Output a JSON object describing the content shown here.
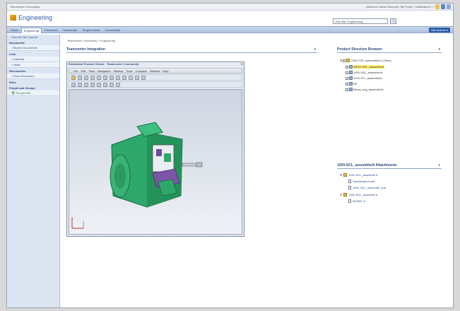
{
  "topbar": {
    "left_text": "Teamcenter Community",
    "right_text": "Welcome Esther Bancroft | My Profile | Notifications | ?"
  },
  "brand": {
    "title": "Engineering"
  },
  "search": {
    "value": "This Site: Engineering",
    "button": "🔍"
  },
  "nav": {
    "tabs": [
      "Home",
      "Engineering",
      "Processes",
      "Teamcenter",
      "Requirements",
      "Connectivity"
    ],
    "active": 1,
    "site_actions": "Site Actions ▾"
  },
  "sidebar": {
    "view_all": "View All Site Content",
    "sections": [
      {
        "header": "Documents",
        "items": [
          "Shared Documents"
        ]
      },
      {
        "header": "Lists",
        "items": [
          "Calendar",
          "Tasks"
        ]
      },
      {
        "header": "Discussions",
        "items": [
          "Team Discussion"
        ]
      },
      {
        "header": "Sites",
        "items": []
      },
      {
        "header": "People and Groups",
        "items": []
      }
    ],
    "recycle_bin": "Recycle Bin"
  },
  "main": {
    "breadcrumb": "Teamcenter Community > Engineering",
    "integration_title": "Teamcenter Integration",
    "viewer_panel_title": "Embedded Product Viewer - Teamcenter Community",
    "viewer_menu": [
      "File",
      "Edit",
      "View",
      "Navigation",
      "Markup",
      "Tools",
      "Compare",
      "Window",
      "Help"
    ],
    "psb_title": "Product Structure Browser",
    "tree": [
      {
        "label": "7094-TOP_assemble/A:1 (View)",
        "level": 0
      },
      {
        "label": "WEST-SHL_assemble/A",
        "level": 1,
        "highlight": true
      },
      {
        "label": "1000-SGL_assemble/A",
        "level": 1
      },
      {
        "label": "1070-STL_assemble/A",
        "level": 1
      },
      {
        "label": "DP",
        "level": 1
      },
      {
        "label": "tiltrcat_eng_assemble/A",
        "level": 1
      }
    ],
    "attachments_title": "1000-SCL_assemble/A Attachments",
    "attachments": [
      {
        "label": "1000-SCL_assemble.A",
        "level": 0,
        "type": "folder"
      },
      {
        "label": "Specifications.pdf",
        "level": 1,
        "type": "doc"
      },
      {
        "label": "1000_SCL_assemble_A.jrt",
        "level": 1,
        "type": "doc"
      },
      {
        "label": "1000-SCL_assemble.A",
        "level": 0,
        "type": "folder"
      },
      {
        "label": "MODEL.A",
        "level": 1,
        "type": "doc"
      }
    ],
    "dropdown_glyph": "▾"
  }
}
